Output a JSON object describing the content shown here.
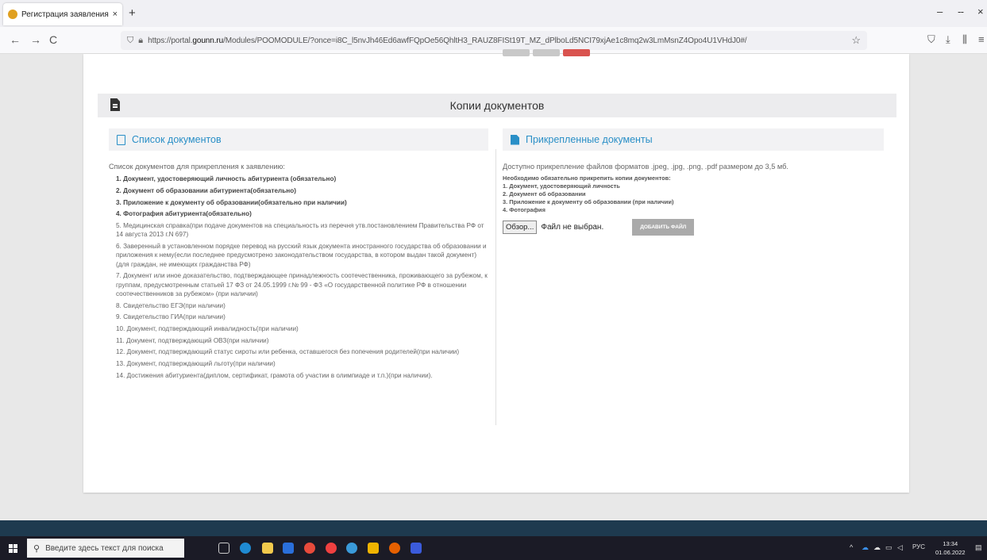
{
  "browser": {
    "tab_title": "Регистрация заявления | Порт",
    "tab_close": "×",
    "new_tab": "+",
    "url_prefix": "https://portal.",
    "url_domain": "gounn.ru",
    "url_rest": "/Modules/POOMODULE/?once=i8C_l5nvJh46Ed6awfFQpOe56QhltH3_RAUZ8FISt19T_MZ_dPlboLd5NCI79xjAe1c8mq2w3LmMsnZ4Opo4U1VHdJ0#/",
    "back": "←",
    "forward": "→",
    "reload": "C",
    "minimize": "–",
    "maximize": "ⵧ",
    "close": "×"
  },
  "section": {
    "title": "Копии документов"
  },
  "left_panel": {
    "title": "Список документов",
    "intro": "Список документов для прикрепления к заявлению:",
    "items": [
      "1. Документ, удостоверяющий личность абитуриента (обязательно)",
      "2. Документ об образовании абитуриента(обязательно)",
      "3. Приложение к документу об образовании(обязательно при наличии)",
      "4. Фотография абитуриента(обязательно)",
      "5. Медицинская справка(при подаче документов на специальность из перечня утв.постановлением Правительства РФ от 14 августа 2013 г.N 697)",
      "6. Заверенный в установленном порядке перевод на русский язык документа иностранного государства об образовании и приложения к нему(если последнее предусмотрено законодательством государства, в котором выдан такой документ)(для граждан, не имеющих гражданства РФ)",
      "7. Документ или иное доказательство, подтверждающее принадлежность соотечественника, проживающего за рубежом, к группам, предусмотренным статьей 17 ФЗ от 24.05.1999 г.№ 99 - ФЗ «О государственной политике РФ в отношении соотечественников за рубежом» (при наличии)",
      "8. Свидетельство ЕГЭ(при наличии)",
      "9. Свидетельство ГИА(при наличии)",
      "10. Документ, подтверждающий инвалидность(при наличии)",
      "11. Документ, подтверждающий ОВЗ(при наличии)",
      "12. Документ, подтверждающий статус сироты или ребенка, оставшегося без попечения родителей(при наличии)",
      "13. Документ, подтверждающий льготу(при наличии)",
      "14. Достижения абитуриента(диплом, сертификат, грамота об участии в олимпиаде и т.п.)(при наличии)."
    ]
  },
  "right_panel": {
    "title": "Прикрепленные документы",
    "formats": "Доступно прикрепление файлов форматов .jpeg, .jpg, .png, .pdf размером до 3,5 мб.",
    "required_title": "Необходимо обязательно прикрепить копии документов:",
    "required": [
      "1. Документ, удостоверяющий личность",
      "2. Документ об образовании",
      "3. Приложение к документу об образовании (при наличии)",
      "4. Фотография"
    ],
    "browse_label": "Обзор...",
    "no_file": "Файл не выбран.",
    "add_file": "ДОБАВИТЬ ФАЙЛ"
  },
  "taskbar": {
    "search_placeholder": "Введите здесь текст для поиска",
    "lang": "РУС",
    "time": "13:34",
    "date": "01.06.2022"
  },
  "colors": {
    "accent": "#2a8fc7",
    "footer": "#1e3a4f",
    "taskbar": "#1b1b26"
  }
}
